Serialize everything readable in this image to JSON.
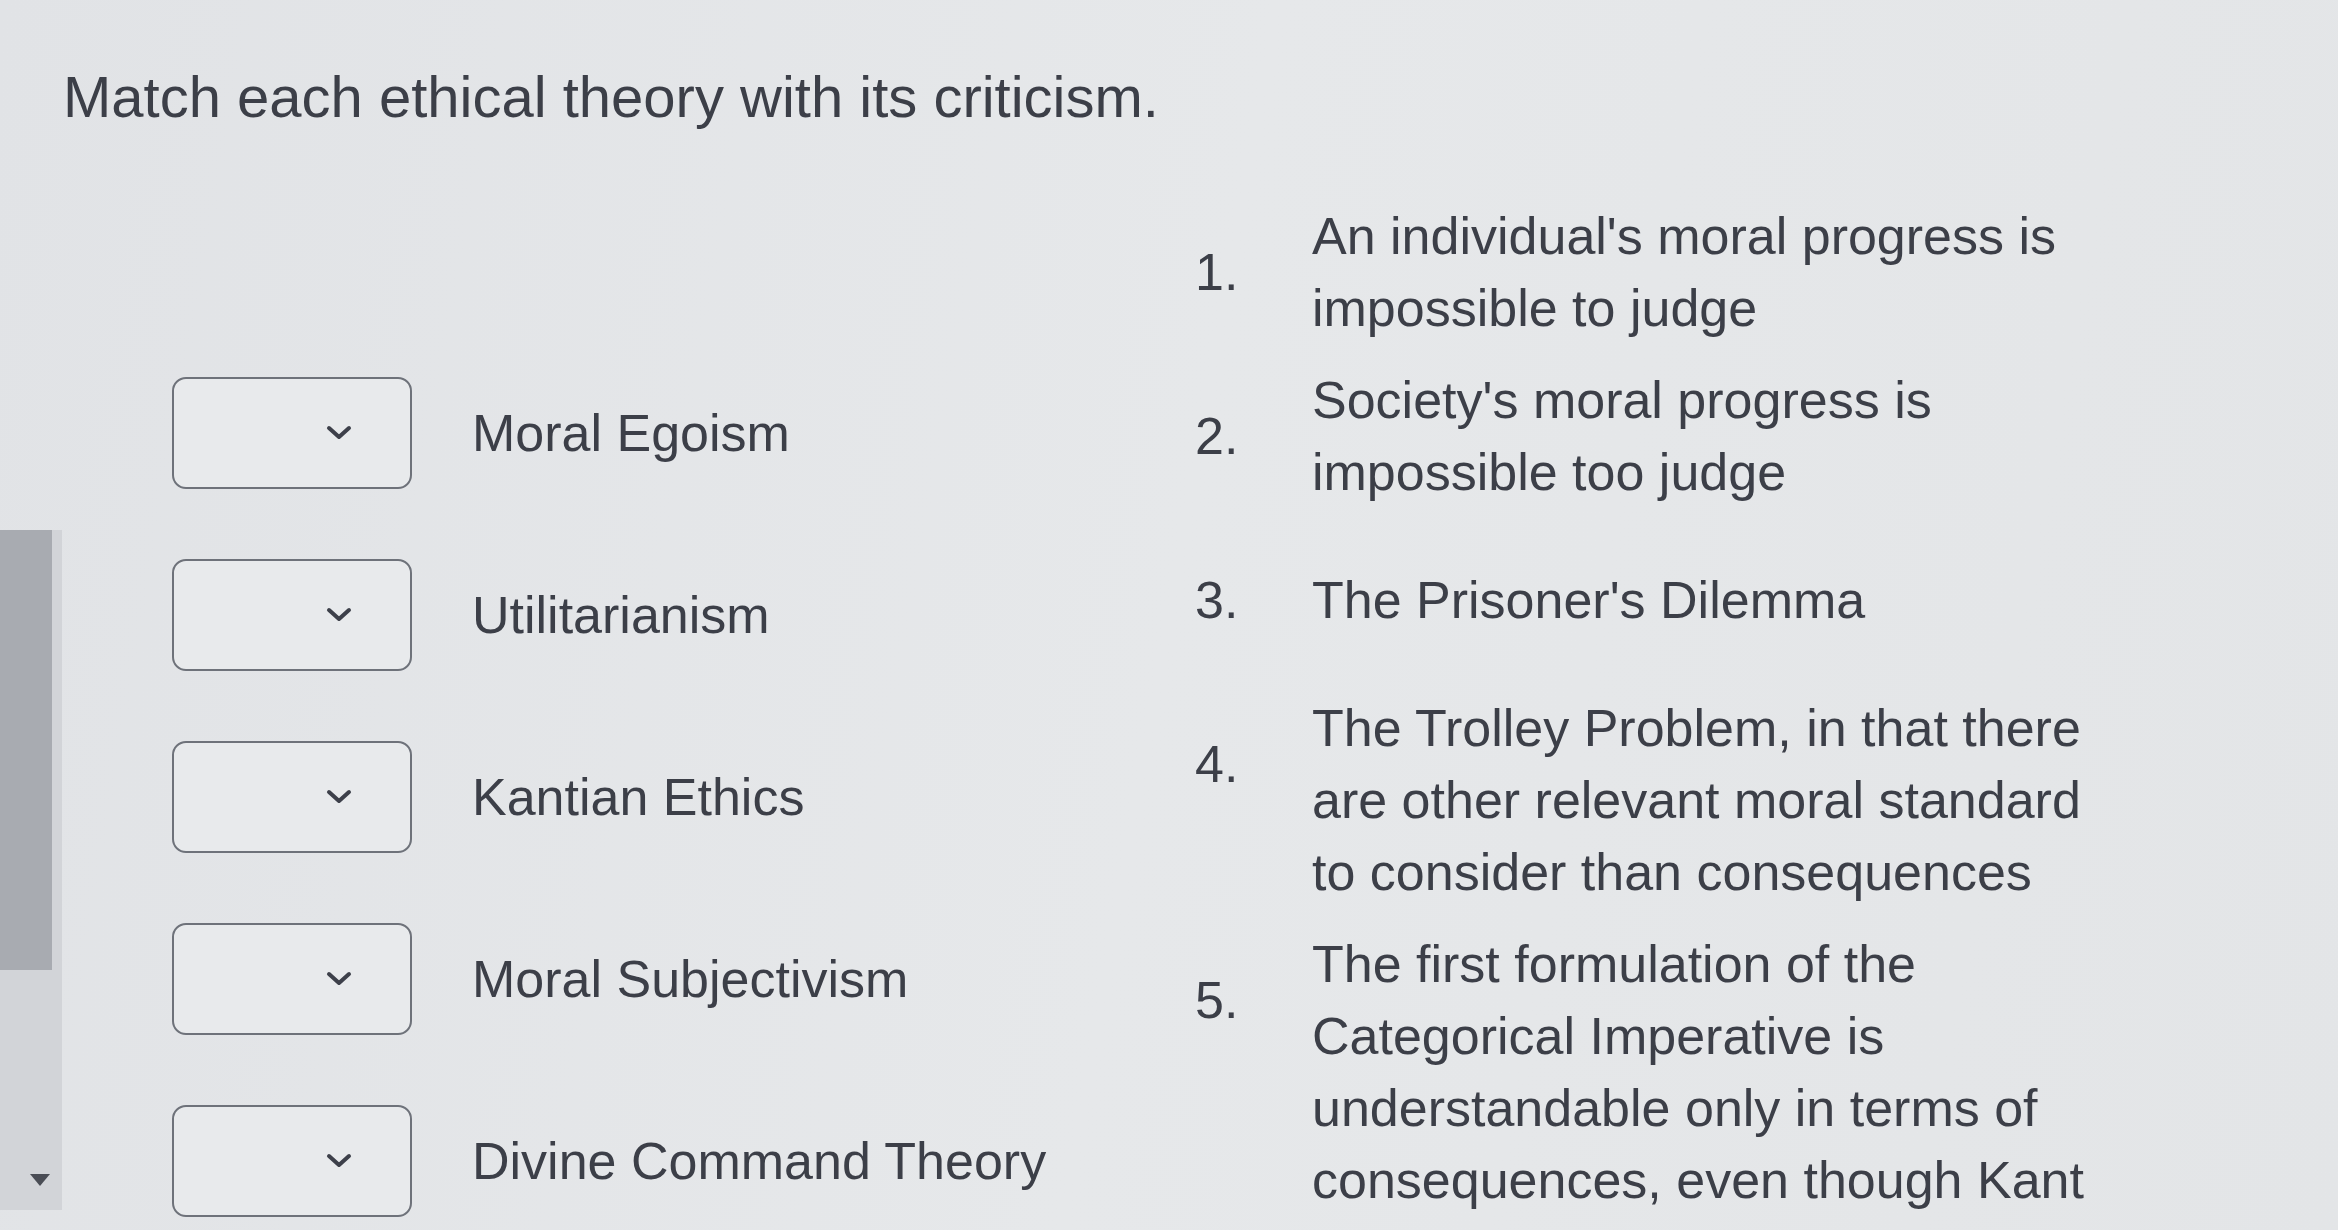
{
  "question": {
    "prompt": "Match each ethical theory with its criticism."
  },
  "theories": [
    {
      "label": "Moral Egoism"
    },
    {
      "label": "Utilitarianism"
    },
    {
      "label": "Kantian Ethics"
    },
    {
      "label": "Moral Subjectivism"
    },
    {
      "label": "Divine Command Theory"
    }
  ],
  "criticisms": [
    {
      "number": "1.",
      "text": "An individual's moral progress is impossible to judge"
    },
    {
      "number": "2.",
      "text": "Society's moral progress is impossible too judge"
    },
    {
      "number": "3.",
      "text": "The Prisoner's Dilemma"
    },
    {
      "number": "4.",
      "text": "The Trolley Problem, in that there are other relevant moral standard to consider than consequences"
    },
    {
      "number": "5.",
      "text": "The first formulation of the Categorical Imperative is understandable only in terms of consequences, even though Kant"
    }
  ]
}
